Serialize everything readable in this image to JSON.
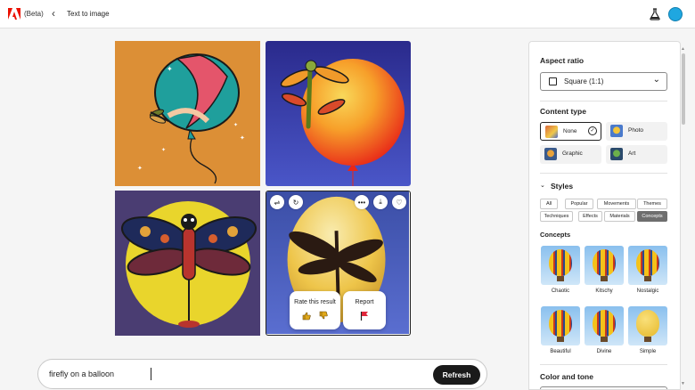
{
  "header": {
    "beta_label": "(Beta)",
    "back_glyph": "‹",
    "breadcrumb": "Text to image",
    "brand_color": "#eb1000",
    "avatar_color": "#1fa7e0"
  },
  "gallery": {
    "images": [
      {
        "name": "balloon-illustration-orange"
      },
      {
        "name": "dragonfly-red-balloon-blue"
      },
      {
        "name": "dragonfly-yellow-circle-purple"
      },
      {
        "name": "dragonfly-silhouette-yellow-balloon"
      }
    ],
    "tile_actions": [
      "⇌",
      "↻",
      "•••",
      "⤓",
      "♡"
    ],
    "rate_label": "Rate this result",
    "report_label": "Report"
  },
  "prompt": {
    "value": "firefly on a balloon",
    "refresh_label": "Refresh"
  },
  "panel": {
    "aspect_ratio": {
      "title": "Aspect ratio",
      "selected": "Square (1:1)"
    },
    "content_type": {
      "title": "Content type",
      "options": [
        {
          "label": "None",
          "selected": true
        },
        {
          "label": "Photo",
          "selected": false
        },
        {
          "label": "Graphic",
          "selected": false
        },
        {
          "label": "Art",
          "selected": false
        }
      ]
    },
    "styles": {
      "title": "Styles",
      "chips_row1": [
        "All",
        "Popular",
        "Movements",
        "Themes"
      ],
      "chips_row2": [
        "Techniques",
        "Effects",
        "Materials",
        "Concepts"
      ],
      "active_chip": "Concepts"
    },
    "concepts": {
      "title": "Concepts",
      "items": [
        "Chaotic",
        "Kitschy",
        "Nostalgic",
        "Beautiful",
        "Divine",
        "Simple"
      ]
    },
    "color_and_tone": {
      "title": "Color and tone"
    }
  }
}
